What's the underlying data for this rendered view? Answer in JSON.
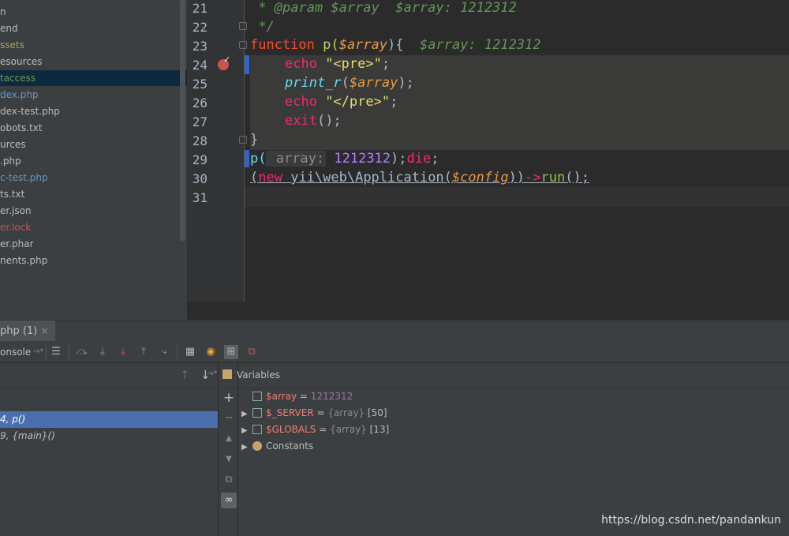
{
  "file_tree": {
    "items": [
      {
        "label": "n",
        "color": "#bbbbbb",
        "selected": false
      },
      {
        "label": "end",
        "color": "#bbbbbb",
        "selected": false
      },
      {
        "label": "ssets",
        "color": "#a6a64b",
        "selected": false
      },
      {
        "label": "esources",
        "color": "#bbbbbb",
        "selected": false
      },
      {
        "label": "taccess",
        "color": "#6a9955",
        "selected": true
      },
      {
        "label": "dex.php",
        "color": "#6897bb",
        "selected": false
      },
      {
        "label": "dex-test.php",
        "color": "#bbbbbb",
        "selected": false
      },
      {
        "label": "obots.txt",
        "color": "#bbbbbb",
        "selected": false
      },
      {
        "label": "urces",
        "color": "#bbbbbb",
        "selected": false
      },
      {
        "label": ".php",
        "color": "#bbbbbb",
        "selected": false
      },
      {
        "label": "c-test.php",
        "color": "#6897bb",
        "selected": false
      },
      {
        "label": "ts.txt",
        "color": "#bbbbbb",
        "selected": false
      },
      {
        "label": "er.json",
        "color": "#bbbbbb",
        "selected": false
      },
      {
        "label": "er.lock",
        "color": "#c75450",
        "selected": false
      },
      {
        "label": "er.phar",
        "color": "#bbbbbb",
        "selected": false
      },
      {
        "label": "nents.php",
        "color": "#bbbbbb",
        "selected": false
      }
    ]
  },
  "editor": {
    "line_numbers": [
      "21",
      "22",
      "23",
      "24",
      "25",
      "26",
      "27",
      "28",
      "29",
      "30",
      "31"
    ],
    "line21": {
      "a": " * @param $array",
      "b": "  $array: 1212312"
    },
    "line22": {
      "a": " */"
    },
    "line23": {
      "kw": "function",
      "name": " p(",
      "var": "$array",
      "rest": "){",
      "hint": "  $array: 1212312"
    },
    "line24": {
      "kw": "echo",
      "str": " \"<pre>\"",
      "end": ";"
    },
    "line25": {
      "fn": "print_r",
      "open": "(",
      "var": "$array",
      "close": ");"
    },
    "line26": {
      "kw": "echo",
      "str": " \"</pre>\"",
      "end": ";"
    },
    "line27": {
      "kw": "exit",
      "rest": "();"
    },
    "line28": {
      "a": "}"
    },
    "line29": {
      "fn": "p(",
      "param": " array:",
      "num": " 1212312",
      "rest": ");",
      "die": "die",
      "end": ";"
    },
    "line30": {
      "open": "(",
      "kw": "new",
      "cls": " yii\\web\\Application(",
      "var": "$config",
      "mid": "))",
      "arrow": "->",
      "run": "run",
      "end": "();"
    }
  },
  "debug": {
    "tab_label": "php (1)",
    "tab_close": "×",
    "console_label": "onsole",
    "console_arrow": "→*",
    "vars_pin": "→*",
    "vars_title": "Variables",
    "frames": [
      {
        "text": "4, p()",
        "selected": true
      },
      {
        "text": "9, {main}()",
        "selected": false
      }
    ],
    "variables": [
      {
        "name": "$array",
        "eq": " = ",
        "value": "1212312",
        "type": "",
        "count": "",
        "expandable": false,
        "icon": "int-icon"
      },
      {
        "name": "$_SERVER",
        "eq": " = ",
        "value": "",
        "type": "{array}",
        "count": " [50]",
        "expandable": true,
        "icon": "array-icon"
      },
      {
        "name": "$GLOBALS",
        "eq": " = ",
        "value": "",
        "type": "{array}",
        "count": " [13]",
        "expandable": true,
        "icon": "array-icon"
      },
      {
        "name": "Constants",
        "eq": "",
        "value": "",
        "type": "",
        "count": "",
        "expandable": true,
        "icon": "constants-icon"
      }
    ]
  },
  "watermark": "https://blog.csdn.net/pandankun"
}
